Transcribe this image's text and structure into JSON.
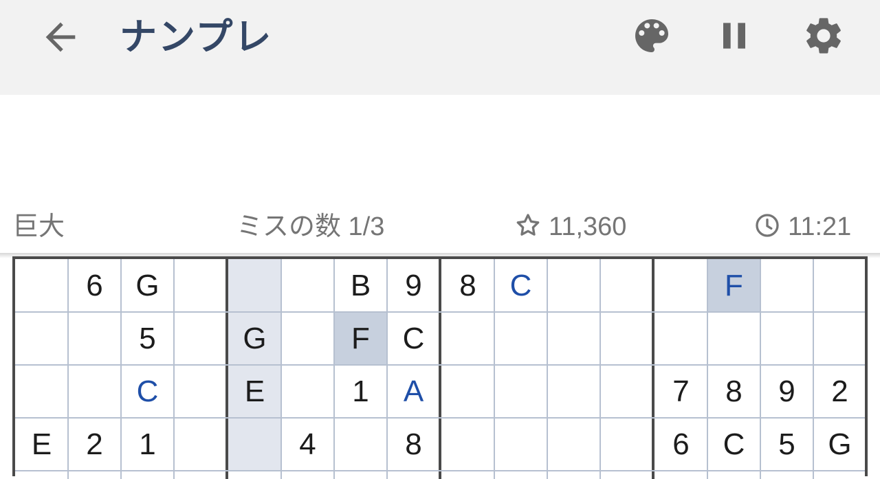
{
  "header": {
    "title": "ナンプレ",
    "back_icon": "arrow-back-icon",
    "palette_icon": "palette-icon",
    "pause_icon": "pause-icon",
    "settings_icon": "gear-icon"
  },
  "status": {
    "difficulty": "巨大",
    "mistakes": "ミスの数 1/3",
    "score": "11,360",
    "time": "11:21"
  },
  "colors": {
    "title": "#344766",
    "given_digit": "#1c1c1c",
    "user_digit": "#1f4fa8",
    "highlight": "#e2e6ee",
    "selected": "#c7d0de"
  },
  "board": {
    "rows": [
      [
        "",
        "6",
        "G",
        "",
        "",
        "",
        "B",
        "9",
        "8",
        "C",
        "",
        "",
        "",
        "F",
        "",
        ""
      ],
      [
        "",
        "",
        "5",
        "",
        "G",
        "",
        "F",
        "C",
        "",
        "",
        "",
        "",
        "",
        "",
        "",
        ""
      ],
      [
        "",
        "",
        "C",
        "",
        "E",
        "",
        "1",
        "A",
        "",
        "",
        "",
        "",
        "7",
        "8",
        "9",
        "2"
      ],
      [
        "E",
        "2",
        "1",
        "",
        "",
        "4",
        "",
        "8",
        "",
        "",
        "",
        "",
        "6",
        "C",
        "5",
        "G"
      ]
    ],
    "user_entered": [
      [
        0,
        9
      ],
      [
        0,
        13
      ],
      [
        2,
        2
      ],
      [
        2,
        7
      ]
    ],
    "selected_cells": [
      [
        0,
        13
      ],
      [
        1,
        6
      ]
    ],
    "highlighted_cells": [
      [
        0,
        4
      ],
      [
        1,
        4
      ],
      [
        2,
        4
      ],
      [
        3,
        4
      ]
    ]
  }
}
